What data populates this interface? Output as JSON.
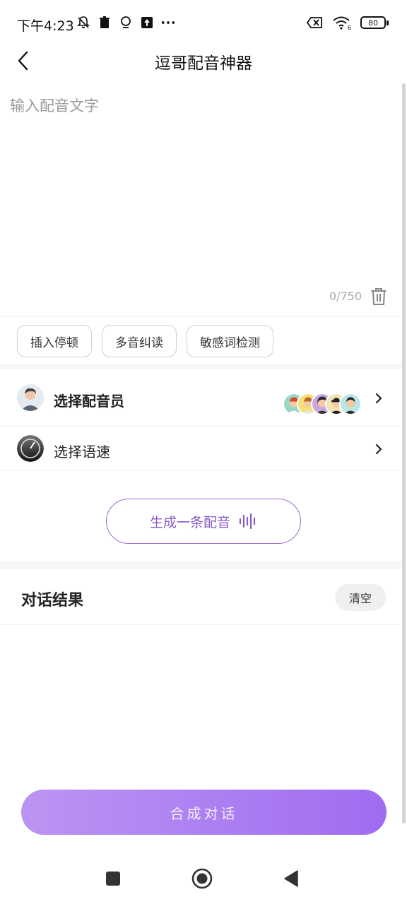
{
  "status_bar": {
    "time": "下午4:23",
    "battery": "80",
    "network": "6"
  },
  "header": {
    "title": "逗哥配音神器"
  },
  "editor": {
    "placeholder": "输入配音文字",
    "value": "",
    "counter": "0/750"
  },
  "tools": [
    {
      "label": "插入停顿"
    },
    {
      "label": "多音纠读"
    },
    {
      "label": "敏感词检测"
    }
  ],
  "options": {
    "voice_actor_label": "选择配音员",
    "speed_label": "选择语速"
  },
  "generate_button_label": "生成一条配音",
  "results": {
    "title": "对话结果",
    "clear_label": "清空"
  },
  "synthesize_button_label": "合成对话",
  "colors": {
    "accent": "#9f6cf1",
    "accent_light": "#bb95f2",
    "outline_purple": "#9b6bd0"
  }
}
